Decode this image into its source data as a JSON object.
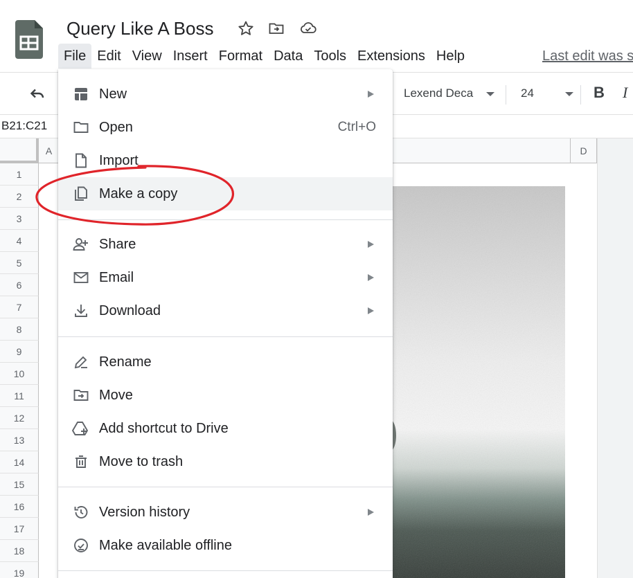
{
  "app": {
    "doc_title": "Query Like A Boss",
    "last_edit": "Last edit was s"
  },
  "menubar": {
    "items": [
      "File",
      "Edit",
      "View",
      "Insert",
      "Format",
      "Data",
      "Tools",
      "Extensions",
      "Help"
    ],
    "active": "File"
  },
  "toolbar": {
    "font": "Lexend Deca",
    "font_size": "24",
    "bold": "B",
    "italic": "I"
  },
  "formula_bar": {
    "name_box": "B21:C21"
  },
  "grid": {
    "columns": [
      "A",
      "D"
    ],
    "rows": [
      "1",
      "2",
      "3",
      "4",
      "5",
      "6",
      "7",
      "8",
      "9",
      "10",
      "11",
      "12",
      "13",
      "14",
      "15",
      "16",
      "17",
      "18",
      "19"
    ]
  },
  "file_menu": {
    "items": [
      {
        "label": "New",
        "icon": "new-sheet-icon",
        "submenu": true
      },
      {
        "label": "Open",
        "icon": "folder-icon",
        "shortcut": "Ctrl+O"
      },
      {
        "label": "Import",
        "icon": "file-icon"
      },
      {
        "label": "Make a copy",
        "icon": "copy-icon",
        "highlighted": true
      },
      {
        "label": "Share",
        "icon": "share-person-icon",
        "submenu": true
      },
      {
        "label": "Email",
        "icon": "email-icon",
        "submenu": true
      },
      {
        "label": "Download",
        "icon": "download-icon",
        "submenu": true
      },
      {
        "label": "Rename",
        "icon": "rename-pencil-icon"
      },
      {
        "label": "Move",
        "icon": "move-folder-icon"
      },
      {
        "label": "Add shortcut to Drive",
        "icon": "drive-shortcut-icon"
      },
      {
        "label": "Move to trash",
        "icon": "trash-icon"
      },
      {
        "label": "Version history",
        "icon": "history-icon",
        "submenu": true
      },
      {
        "label": "Make available offline",
        "icon": "offline-check-icon"
      }
    ]
  },
  "colors": {
    "sheets_green": "#188038",
    "annotation_red": "#e0242a",
    "menu_hover": "#f1f3f4",
    "text_primary": "#202124",
    "text_secondary": "#5f6368"
  }
}
